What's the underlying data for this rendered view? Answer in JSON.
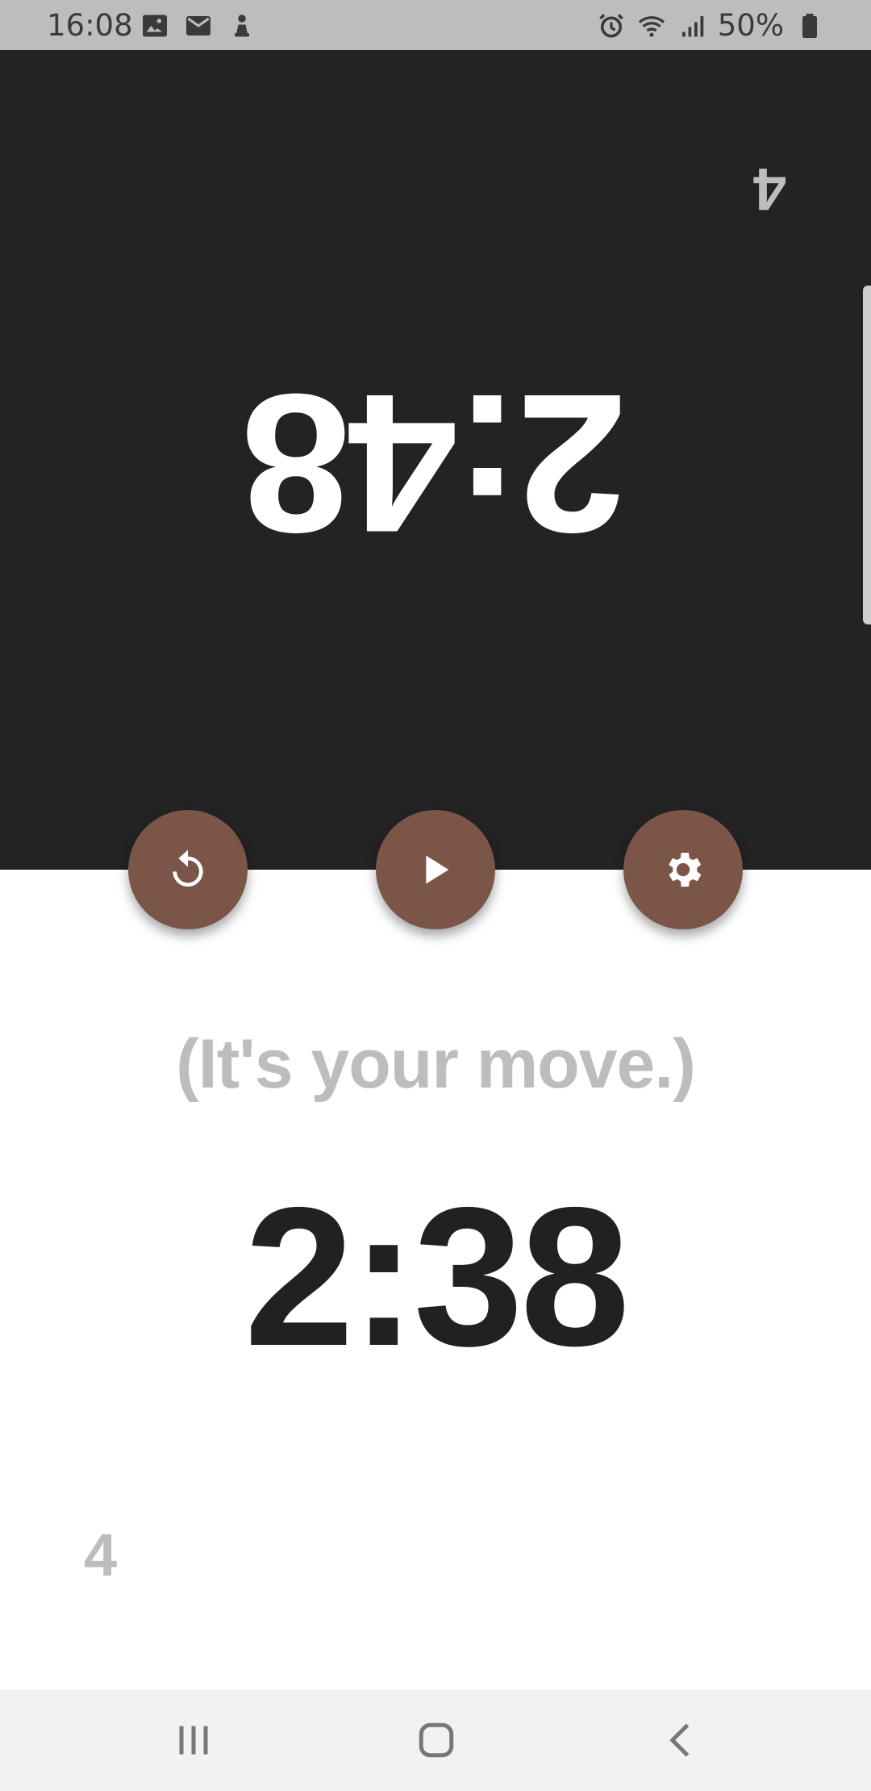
{
  "status_bar": {
    "time": "16:08",
    "battery": "50%",
    "left_icons": [
      "gallery-icon",
      "mail-icon",
      "chess-pawn-icon"
    ],
    "right_icons": [
      "alarm-icon",
      "wifi-icon",
      "signal-icon",
      "battery-icon"
    ]
  },
  "opponent": {
    "time": "2:48",
    "move_count": "4"
  },
  "controls": {
    "reset_icon": "reset-icon",
    "play_icon": "play-icon",
    "settings_icon": "gear-icon"
  },
  "player": {
    "status_text": "(It's your move.)",
    "time": "2:38",
    "move_count": "4"
  },
  "nav_bar": {
    "icons": [
      "recents-icon",
      "home-icon",
      "back-icon"
    ]
  },
  "colors": {
    "button": "#7b5548",
    "dark_panel": "#232323",
    "muted_text": "#bdbdbd"
  }
}
